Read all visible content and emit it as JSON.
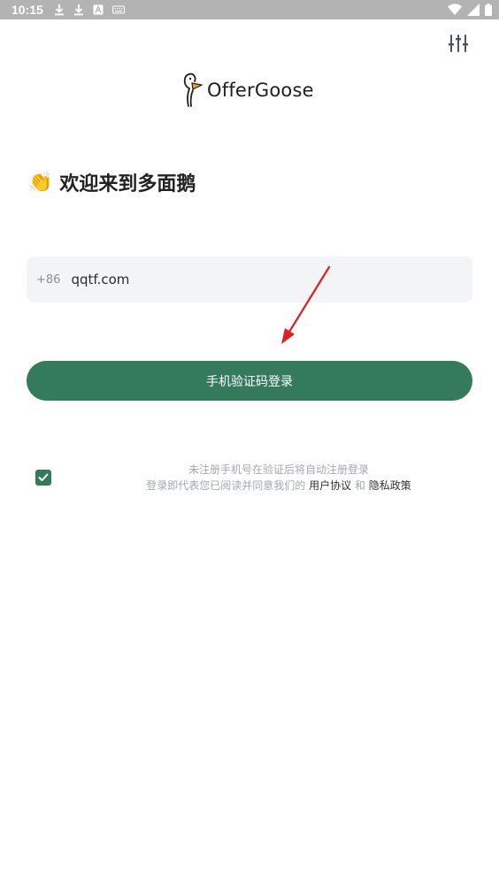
{
  "status_bar": {
    "time": "10:15"
  },
  "app": {
    "logo_text": "OfferGoose"
  },
  "welcome": {
    "emoji": "👏",
    "text": "欢迎来到多面鹅"
  },
  "phone": {
    "country_code": "+86",
    "value": "qqtf.com"
  },
  "login_button": {
    "label": "手机验证码登录"
  },
  "agreement": {
    "line1": "未注册手机号在验证后将自动注册登录",
    "line2_prefix": "登录即代表您已阅读并同意我们的",
    "user_agreement": "用户协议",
    "conjunction": "和",
    "privacy_policy": "隐私政策",
    "checked": true
  },
  "colors": {
    "accent": "#347b5e",
    "annotation_arrow": "#e02020"
  }
}
